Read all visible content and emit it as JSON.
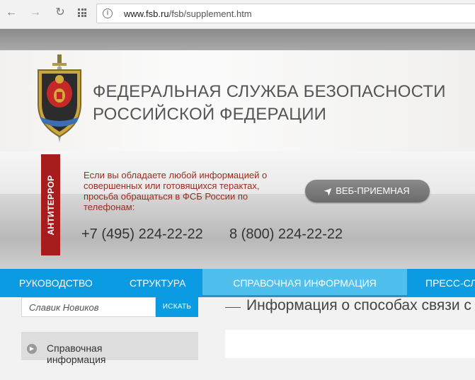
{
  "browser": {
    "url_host": "www.fsb.ru",
    "url_path": "/fsb/supplement.htm"
  },
  "header": {
    "title_line1": "ФЕДЕРАЛЬНАЯ СЛУЖБА БЕЗОПАСНОСТИ",
    "title_line2": "РОССИЙСКОЙ ФЕДЕРАЦИИ"
  },
  "antiterror": {
    "tag": "АНТИТЕРРОР",
    "message": "Если вы обладаете любой информацией о совершенных или готовящихся терактах, просьба обращаться в ФСБ России по телефонам:",
    "phone1": "+7 (495) 224-22-22",
    "phone2": "8 (800) 224-22-22",
    "web_button": "ВЕБ-ПРИЕМНАЯ"
  },
  "nav": {
    "items": [
      {
        "label": "РУКОВОДСТВО"
      },
      {
        "label": "СТРУКТУРА"
      },
      {
        "label": "СПРАВОЧНАЯ ИНФОРМАЦИЯ"
      },
      {
        "label": "ПРЕСС-СЛ"
      }
    ],
    "active_index": 2
  },
  "search": {
    "value": "Славик Новиков",
    "button": "ИСКАТЬ"
  },
  "sidebar": {
    "items": [
      {
        "label": "Справочная информация"
      }
    ]
  },
  "main": {
    "section_title": "Информация о способах связи с Ф"
  },
  "colors": {
    "nav_bg": "#0a9be2",
    "nav_active": "#4fc0ee",
    "antiterror_red": "#a71c1c",
    "alert_text": "#9b2b1e"
  }
}
